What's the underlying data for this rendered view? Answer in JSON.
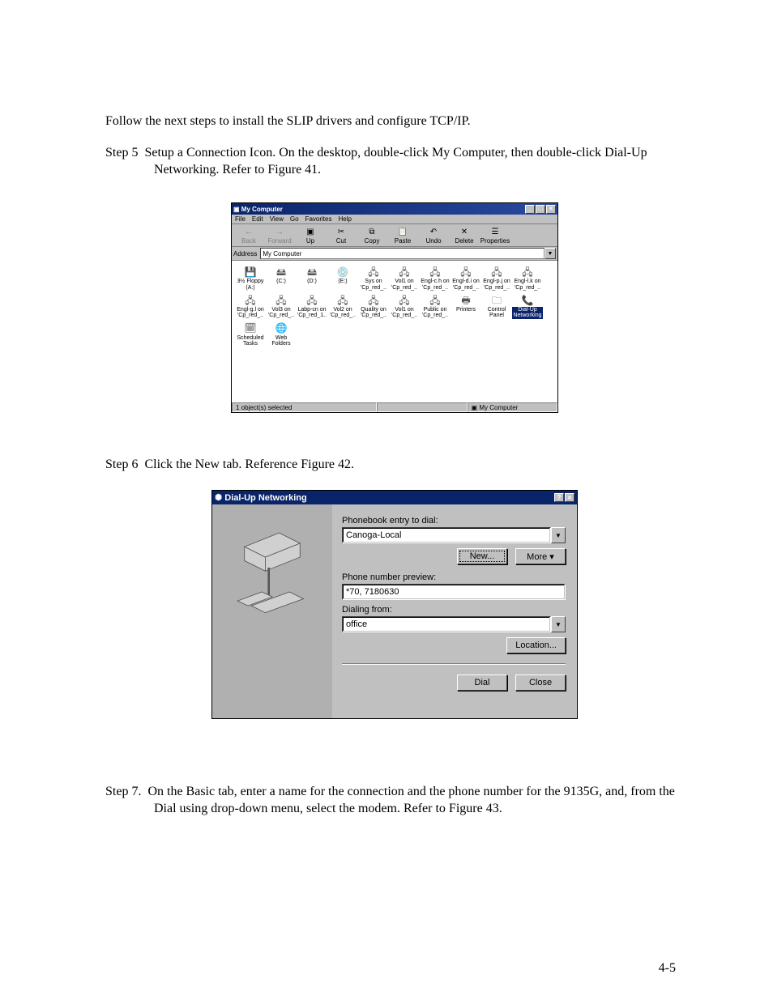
{
  "intro": "Follow the next steps to install the SLIP drivers and configure TCP/IP.",
  "step5_label": "Step 5",
  "step5_text": "Setup a Connection Icon. On the desktop, double-click My Computer, then double-click Dial-Up Networking. Refer to Figure 41.",
  "step6_label": "Step 6",
  "step6_text": "Click the New tab. Reference Figure 42.",
  "step7_label": "Step 7.",
  "step7_text": "On the Basic tab, enter a name for the connection and the phone number for the 9135G, and, from the Dial using drop-down menu, select the modem. Refer to Figure 43.",
  "page_number": "4-5",
  "my_computer": {
    "title": "My Computer",
    "menu": [
      "File",
      "Edit",
      "View",
      "Go",
      "Favorites",
      "Help"
    ],
    "toolbar": [
      {
        "label": "Back",
        "glyph": "←",
        "disabled": true
      },
      {
        "label": "Forward",
        "glyph": "→",
        "disabled": true
      },
      {
        "label": "Up",
        "glyph": "▣",
        "disabled": false
      },
      {
        "label": "Cut",
        "glyph": "✂",
        "disabled": false
      },
      {
        "label": "Copy",
        "glyph": "⧉",
        "disabled": false
      },
      {
        "label": "Paste",
        "glyph": "📋",
        "disabled": false
      },
      {
        "label": "Undo",
        "glyph": "↶",
        "disabled": false
      },
      {
        "label": "Delete",
        "glyph": "✕",
        "disabled": false
      },
      {
        "label": "Properties",
        "glyph": "☰",
        "disabled": false
      }
    ],
    "address_label": "Address",
    "address_value": "My Computer",
    "icons": [
      {
        "label": "3½ Floppy (A:)",
        "glyph": "💾"
      },
      {
        "label": "(C:)",
        "glyph": "🖴"
      },
      {
        "label": "(D:)",
        "glyph": "🖴"
      },
      {
        "label": "(E:)",
        "glyph": "💿"
      },
      {
        "label": "Sys on 'Cp_red_..",
        "glyph": "🖧"
      },
      {
        "label": "Vol1 on 'Cp_red_..",
        "glyph": "🖧"
      },
      {
        "label": "Engl-c.h on 'Cp_red_..",
        "glyph": "🖧"
      },
      {
        "label": "Engl-d.i on 'Cp_red_..",
        "glyph": "🖧"
      },
      {
        "label": "Engl-p.j on 'Cp_red_..",
        "glyph": "🖧"
      },
      {
        "label": "Engl-l.k on 'Cp_red_..",
        "glyph": "🖧"
      },
      {
        "label": "Engl-g.l on 'Cp_red_..",
        "glyph": "🖧"
      },
      {
        "label": "Vol3 on 'Cp_red_..",
        "glyph": "🖧"
      },
      {
        "label": "Labp-cn on 'Cp_red_1..",
        "glyph": "🖧"
      },
      {
        "label": "Vol2 on 'Cp_red_..",
        "glyph": "🖧"
      },
      {
        "label": "Quality on 'Cp_red_..",
        "glyph": "🖧"
      },
      {
        "label": "Vol1 on 'Cp_red_..",
        "glyph": "🖧"
      },
      {
        "label": "Public on 'Cp_red_..",
        "glyph": "🖧"
      },
      {
        "label": "Printers",
        "glyph": "🖶"
      },
      {
        "label": "Control Panel",
        "glyph": "🗀"
      },
      {
        "label": "Dial-Up Networking",
        "glyph": "📞",
        "selected": true
      },
      {
        "label": "Scheduled Tasks",
        "glyph": "🗓"
      },
      {
        "label": "Web Folders",
        "glyph": "🌐"
      }
    ],
    "status_left": "1 object(s) selected",
    "status_right": "My Computer"
  },
  "dun": {
    "title": "Dial-Up Networking",
    "entry_label": "Phonebook entry to dial:",
    "entry_value": "Canoga-Local",
    "new_btn": "New...",
    "more_btn": "More ▾",
    "preview_label": "Phone number preview:",
    "preview_value": "*70, 7180630",
    "from_label": "Dialing from:",
    "from_value": "office",
    "location_btn": "Location...",
    "dial_btn": "Dial",
    "close_btn": "Close"
  }
}
